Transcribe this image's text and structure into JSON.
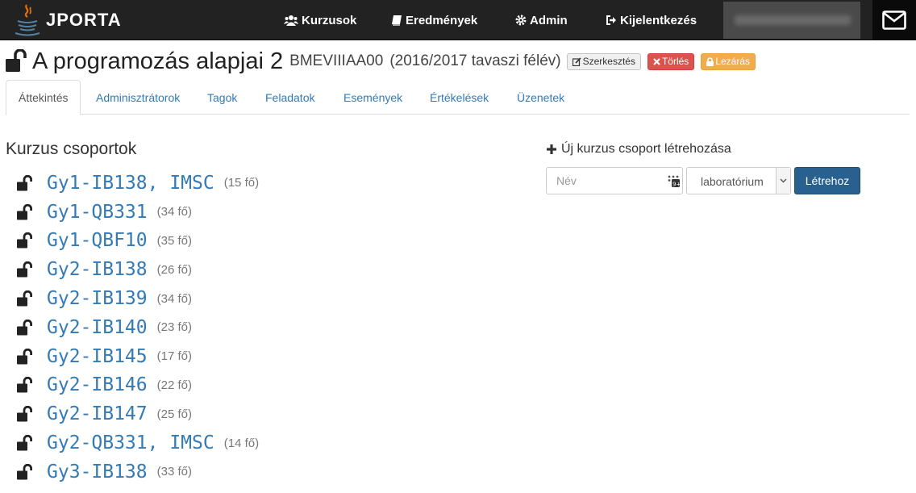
{
  "navbar": {
    "brand": "JPORTA",
    "items": [
      {
        "label": "Kurzusok",
        "icon": "users-icon"
      },
      {
        "label": "Eredmények",
        "icon": "book-icon"
      },
      {
        "label": "Admin",
        "icon": "cog-icon"
      },
      {
        "label": "Kijelentkezés",
        "icon": "sign-out-icon"
      }
    ],
    "mail_icon": "envelope-icon"
  },
  "course": {
    "title": "A programozás alapjai 2",
    "code": "BMEVIIIAA00",
    "semester": "(2016/2017 tavaszi félév)",
    "buttons": {
      "edit": "Szerkesztés",
      "delete": "Törlés",
      "lock": "Lezárás"
    }
  },
  "tabs": [
    {
      "label": "Áttekintés",
      "active": true
    },
    {
      "label": "Adminisztrátorok",
      "active": false
    },
    {
      "label": "Tagok",
      "active": false
    },
    {
      "label": "Feladatok",
      "active": false
    },
    {
      "label": "Események",
      "active": false
    },
    {
      "label": "Értékelések",
      "active": false
    },
    {
      "label": "Üzenetek",
      "active": false
    }
  ],
  "groups": {
    "title": "Kurzus csoportok",
    "items": [
      {
        "name": "Gy1-IB138, IMSC",
        "count": "(15 fő)"
      },
      {
        "name": "Gy1-QB331",
        "count": "(34 fő)"
      },
      {
        "name": "Gy1-QBF10",
        "count": "(35 fő)"
      },
      {
        "name": "Gy2-IB138",
        "count": "(26 fő)"
      },
      {
        "name": "Gy2-IB139",
        "count": "(34 fő)"
      },
      {
        "name": "Gy2-IB140",
        "count": "(23 fő)"
      },
      {
        "name": "Gy2-IB145",
        "count": "(17 fő)"
      },
      {
        "name": "Gy2-IB146",
        "count": "(22 fő)"
      },
      {
        "name": "Gy2-IB147",
        "count": "(25 fő)"
      },
      {
        "name": "Gy2-QB331, IMSC",
        "count": "(14 fő)"
      },
      {
        "name": "Gy3-IB138",
        "count": "(33 fő)"
      }
    ]
  },
  "new_group": {
    "title": "Új kurzus csoport létrehozása",
    "name_placeholder": "Név",
    "type_value": "laboratórium",
    "submit": "Létrehoz"
  }
}
